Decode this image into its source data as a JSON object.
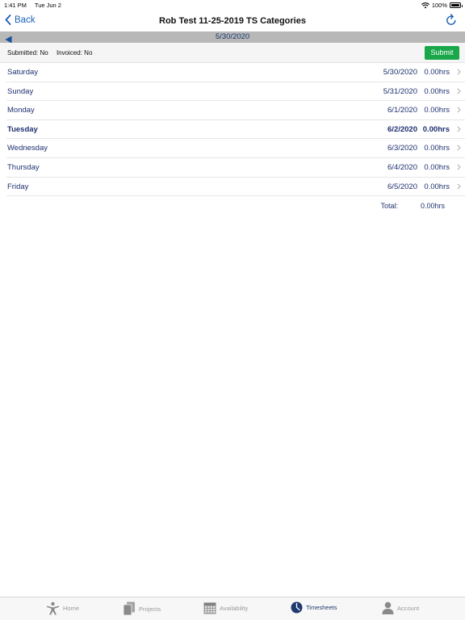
{
  "status": {
    "time": "1:41 PM",
    "date": "Tue Jun 2",
    "battery": "100%"
  },
  "nav": {
    "back_label": "Back",
    "title": "Rob Test 11-25-2019 TS Categories"
  },
  "date_bar": {
    "label": "5/30/2020"
  },
  "summary": {
    "submitted": "Submitted: No",
    "invoiced": "Invoiced: No",
    "submit_label": "Submit"
  },
  "days": [
    {
      "day": "Saturday",
      "date": "5/30/2020",
      "hours": "0.00hrs"
    },
    {
      "day": "Sunday",
      "date": "5/31/2020",
      "hours": "0.00hrs"
    },
    {
      "day": "Monday",
      "date": "6/1/2020",
      "hours": "0.00hrs"
    },
    {
      "day": "Tuesday",
      "date": "6/2/2020",
      "hours": "0.00hrs"
    },
    {
      "day": "Wednesday",
      "date": "6/3/2020",
      "hours": "0.00hrs"
    },
    {
      "day": "Thursday",
      "date": "6/4/2020",
      "hours": "0.00hrs"
    },
    {
      "day": "Friday",
      "date": "6/5/2020",
      "hours": "0.00hrs"
    }
  ],
  "total": {
    "label": "Total:",
    "value": "0.00hrs"
  },
  "tabs": [
    {
      "label": "Home",
      "icon": "person-icon"
    },
    {
      "label": "Projects",
      "icon": "documents-icon"
    },
    {
      "label": "Availability",
      "icon": "calendar-icon"
    },
    {
      "label": "Timesheets",
      "icon": "clock-icon"
    },
    {
      "label": "Account",
      "icon": "user-icon"
    }
  ],
  "colors": {
    "accent": "#1a5fb4",
    "submit": "#1aa74a",
    "text_blue": "#1f3070",
    "tab_active": "#1f3a6e",
    "tab_inactive": "#9a9a9a"
  }
}
